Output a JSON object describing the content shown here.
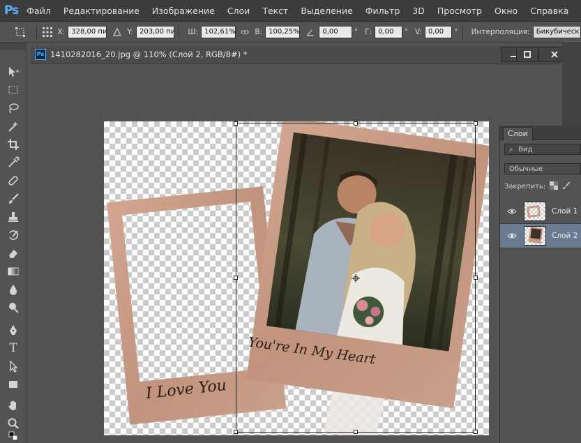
{
  "app": {
    "logo": "Ps"
  },
  "menu": [
    "Файл",
    "Редактирование",
    "Изображение",
    "Слои",
    "Текст",
    "Выделение",
    "Фильтр",
    "3D",
    "Просмотр",
    "Окно",
    "Справка"
  ],
  "options": {
    "x_label": "X:",
    "x_value": "328,00 пи",
    "y_label": "Y:",
    "y_value": "203,00 пи",
    "w_label": "Ш:",
    "w_value": "102,61%",
    "h_label": "В:",
    "h_value": "100,25%",
    "angle_value": "0,00",
    "angle_unit": "°",
    "g_label": "Г:",
    "g_value": "0,00",
    "g_unit": "°",
    "v_label": "V:",
    "v_value": "0,00",
    "v_unit": "°",
    "interp_label": "Интерполяция:",
    "interp_value": "Бикубическ"
  },
  "document": {
    "title": "1410282016_20.jpg @ 110% (Слой 2, RGB/8#) *",
    "tab_icon": "Ps"
  },
  "artwork": {
    "left_frame_text": "I Love You",
    "right_frame_text": "You're In My Heart"
  },
  "layers_panel": {
    "tab": "Слои",
    "filter_placeholder": "Вид",
    "blend_mode": "Обычные",
    "lock_label": "Закрепить:",
    "layers": [
      {
        "name": "Слой 1",
        "visible": true,
        "active": false
      },
      {
        "name": "Слой 2",
        "visible": true,
        "active": true
      }
    ]
  },
  "icons": {
    "move": "move-icon",
    "marquee": "rect-marquee-icon",
    "lasso": "lasso-icon",
    "wand": "magic-wand-icon",
    "crop": "crop-icon",
    "eyedropper": "eyedropper-icon",
    "heal": "healing-brush-icon",
    "brush": "brush-icon",
    "stamp": "clone-stamp-icon",
    "history": "history-brush-icon",
    "eraser": "eraser-icon",
    "gradient": "gradient-icon",
    "blur": "blur-icon",
    "dodge": "dodge-icon",
    "pen": "pen-icon",
    "type": "type-icon",
    "path": "path-selection-icon",
    "shape": "rectangle-shape-icon",
    "hand": "hand-icon",
    "zoom": "zoom-icon"
  },
  "colors": {
    "ps_blue": "#5fb2ff",
    "frame": "#c89a84",
    "active_layer": "#6a7a90"
  }
}
